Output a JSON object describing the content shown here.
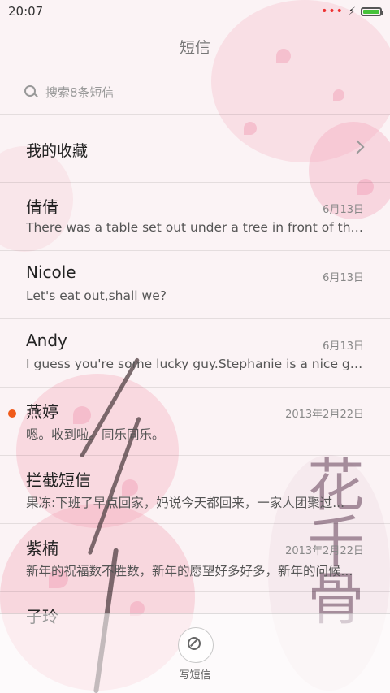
{
  "status": {
    "time": "20:07",
    "signal_dots": "•••",
    "charging": "⚡",
    "battery_level": 1.0
  },
  "header": {
    "title": "短信"
  },
  "search": {
    "placeholder": "搜索8条短信"
  },
  "favorites": {
    "label": "我的收藏"
  },
  "conversations": [
    {
      "name": "倩倩",
      "date": "6月13日",
      "preview": "There was a table set out under a tree in front of the ho...",
      "unread": false
    },
    {
      "name": "Nicole",
      "date": "6月13日",
      "preview": "Let's eat out,shall we?",
      "unread": false
    },
    {
      "name": "Andy",
      "date": "6月13日",
      "preview": "I guess you're some lucky guy.Stephanie is a nice girl.",
      "unread": false
    },
    {
      "name": "燕婷",
      "date": "2013年2月22日",
      "preview": "嗯。收到啦。同乐同乐。",
      "unread": true
    },
    {
      "name": "拦截短信",
      "date": "",
      "preview": "果冻:下班了早点回家，妈说今天都回来，一家人团聚过...",
      "unread": false
    },
    {
      "name": "紫楠",
      "date": "2013年2月22日",
      "preview": "新年的祝福数不胜数，新年的愿望好多好多，新年的问候...",
      "unread": false
    },
    {
      "name": "子玲",
      "date": "",
      "preview": "",
      "unread": false
    }
  ],
  "compose": {
    "label": "写短信"
  },
  "decor": {
    "calligraphy": "花千骨"
  },
  "colors": {
    "unread_dot": "#f05a1a",
    "battery": "#46c23a",
    "blossom": "#f3a6bb"
  }
}
